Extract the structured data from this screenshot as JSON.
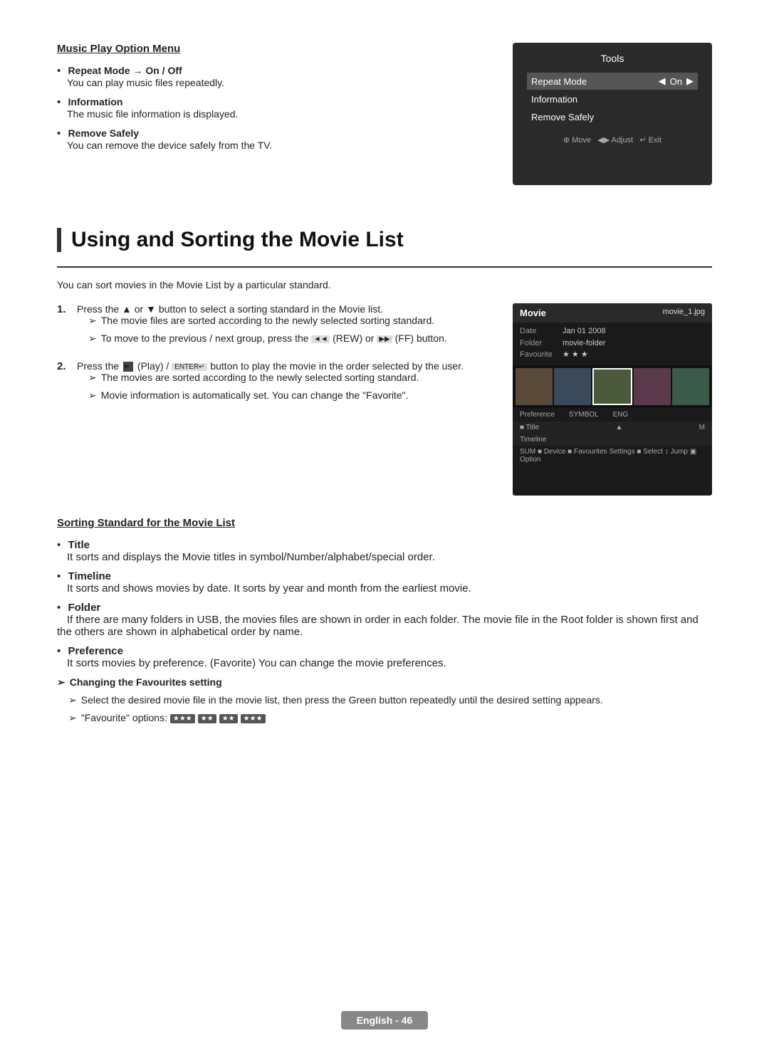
{
  "music": {
    "section_heading": "Music Play Option Menu",
    "items": [
      {
        "label": "Repeat Mode → On / Off",
        "desc": "You can play music files repeatedly."
      },
      {
        "label": "Information",
        "desc": "The music file information is displayed."
      },
      {
        "label": "Remove Safely",
        "desc": "You can remove the device safely from the TV."
      }
    ]
  },
  "tools_panel": {
    "title": "Tools",
    "rows": [
      {
        "label": "Repeat Mode",
        "value": "On",
        "selected": true
      },
      {
        "label": "Information",
        "value": "",
        "selected": false
      },
      {
        "label": "Remove Safely",
        "value": "",
        "selected": false
      }
    ],
    "footer": "▲ Move  ◀▶ Adjust  ← Exit"
  },
  "chapter": {
    "title": "Using and Sorting the Movie List",
    "intro": "You can sort movies in the Movie List by a particular standard."
  },
  "steps": [
    {
      "num": "1.",
      "text": "Press the ▲ or ▼ button to select a sorting standard in the Movie list.",
      "arrows": [
        "The movie files are sorted according to the newly selected sorting standard.",
        "To move to the previous / next group, press the [◄◄] (REW) or [▶▶] (FF) button."
      ]
    },
    {
      "num": "2.",
      "text": "Press the [▶] (Play) / ENTER↵ button to play the movie in the order selected by the user.",
      "arrows": [
        "The movies are sorted according to the newly selected sorting standard.",
        "Movie information is automatically set. You can change the \"Favorite\"."
      ]
    }
  ],
  "movie_panel": {
    "title": "Movie",
    "filename": "movie_1.jpg",
    "info_rows": [
      {
        "key": "Date",
        "value": "Jan 01 2008"
      },
      {
        "key": "Folder",
        "value": "movie-folder"
      },
      {
        "key": "Favourite",
        "value": "★★★"
      }
    ],
    "sort_labels": [
      "Preference",
      "SYMBOL",
      "ENG"
    ],
    "nav_row": "Title  ▲  M",
    "timeline_row": "Timeline",
    "bottom_row": "SUM  ■ Device  ■ Favourites Settings  ■ Select  ↕ Jump  ▣ Option"
  },
  "sorting": {
    "heading": "Sorting Standard for the Movie List",
    "items": [
      {
        "label": "Title",
        "desc": "It sorts and displays the Movie titles in symbol/Number/alphabet/special order."
      },
      {
        "label": "Timeline",
        "desc": "It sorts and shows movies by date. It sorts by year and month from the earliest movie."
      },
      {
        "label": "Folder",
        "desc": "If there are many folders in USB, the movies files are shown in order in each folder. The movie file in the Root folder is shown first and the others are shown in alphabetical order by name."
      },
      {
        "label": "Preference",
        "desc": "It sorts movies by preference. (Favorite) You can change the movie preferences."
      }
    ],
    "changing_heading": "Changing the Favourites setting",
    "changing_arrows": [
      "Select the desired movie file in the movie list, then press the Green button repeatedly until the desired setting appears.",
      "\"Favourite\" options:"
    ],
    "fav_options": [
      "★★★",
      "★★",
      "★★",
      "★★★"
    ]
  },
  "footer": {
    "label": "English - 46"
  }
}
